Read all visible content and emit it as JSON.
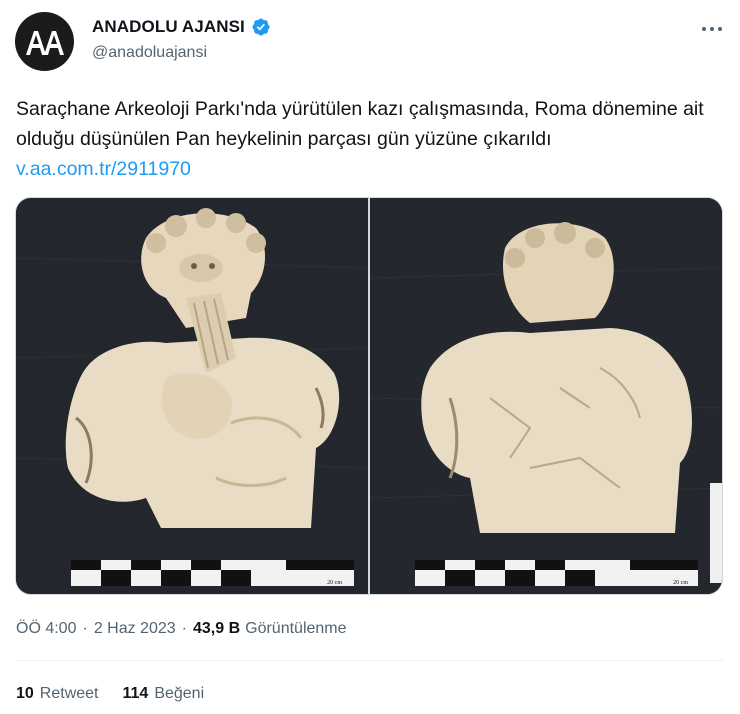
{
  "author": {
    "display_name": "ANADOLU AJANSI",
    "handle": "@anadoluajansi",
    "avatar_text": "AA",
    "verified": true
  },
  "tweet": {
    "text": "Saraçhane Arkeoloji Parkı'nda yürütülen kazı çalışmasında, Roma dönemine ait olduğu düşünülen Pan heykelinin parçası gün yüzüne çıkarıldı ",
    "link": "v.aa.com.tr/2911970"
  },
  "media": {
    "photos": [
      {
        "scale_label": "20 cm"
      },
      {
        "scale_label": "20 cm"
      }
    ]
  },
  "meta": {
    "time": "ÖÖ 4:00",
    "date": "2 Haz 2023",
    "views_count": "43,9 B",
    "views_label": "Görüntülenme",
    "separator": "·"
  },
  "stats": {
    "retweets_count": "10",
    "retweets_label": "Retweet",
    "likes_count": "114",
    "likes_label": "Beğeni"
  },
  "colors": {
    "link": "#1d9bf0",
    "secondary_text": "#536471",
    "verified": "#1d9bf0"
  }
}
